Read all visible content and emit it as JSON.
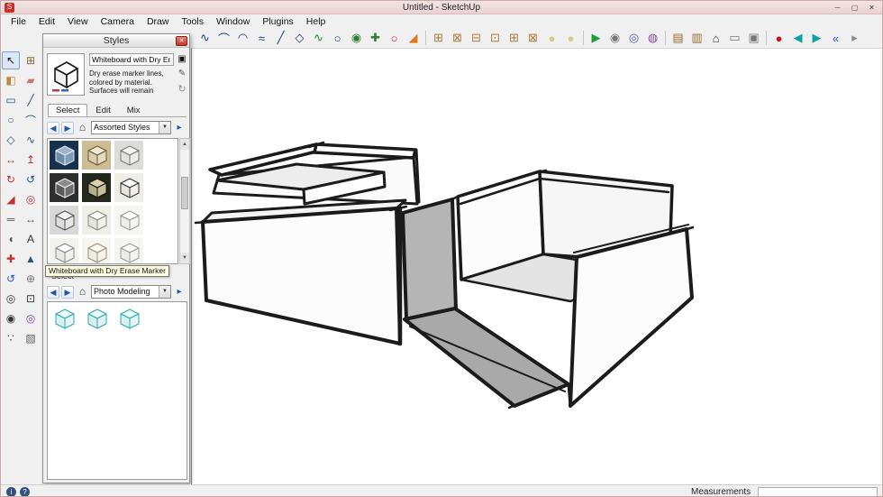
{
  "window": {
    "title": "Untitled - SketchUp",
    "logo_glyph": "S",
    "controls": {
      "minimize": "─",
      "maximize": "▢",
      "close": "✕"
    }
  },
  "menu": {
    "items": [
      {
        "name": "menu-file",
        "label": "File"
      },
      {
        "name": "menu-edit",
        "label": "Edit"
      },
      {
        "name": "menu-view",
        "label": "View"
      },
      {
        "name": "menu-camera",
        "label": "Camera"
      },
      {
        "name": "menu-draw",
        "label": "Draw"
      },
      {
        "name": "menu-tools",
        "label": "Tools"
      },
      {
        "name": "menu-window",
        "label": "Window"
      },
      {
        "name": "menu-plugins",
        "label": "Plugins"
      },
      {
        "name": "menu-help",
        "label": "Help"
      }
    ]
  },
  "toolbar": {
    "group_draw": [
      {
        "name": "freehand-icon",
        "glyph": "∿",
        "color": "#1f3f77"
      },
      {
        "name": "arc-icon",
        "glyph": "⌒",
        "color": "#1f3f77"
      },
      {
        "name": "arc-segment-icon",
        "glyph": "◠",
        "color": "#1f3f77"
      },
      {
        "name": "bezier-icon",
        "glyph": "≈",
        "color": "#1f3f77"
      },
      {
        "name": "line-icon",
        "glyph": "╱",
        "color": "#1f3f77"
      },
      {
        "name": "polygon-icon",
        "glyph": "◇",
        "color": "#1f3f77"
      },
      {
        "name": "sine-curve-icon",
        "glyph": "∿",
        "color": "#2e7d32"
      },
      {
        "name": "circle-icon",
        "glyph": "○",
        "color": "#1f3f77"
      },
      {
        "name": "spiral-icon",
        "glyph": "◉",
        "color": "#2e7d32"
      },
      {
        "name": "wrench-icon",
        "glyph": "✚",
        "color": "#2e7d32"
      },
      {
        "name": "ellipse-icon",
        "glyph": "○",
        "color": "#cc2222"
      },
      {
        "name": "wedge-icon",
        "glyph": "◢",
        "color": "#e07820"
      }
    ],
    "group_solid": [
      {
        "name": "outer-shell-icon",
        "glyph": "⊞",
        "color": "#a97c3c"
      },
      {
        "name": "intersect-icon",
        "glyph": "⊠",
        "color": "#a97c3c"
      },
      {
        "name": "union-icon",
        "glyph": "⊟",
        "color": "#a97c3c"
      },
      {
        "name": "subtract-icon",
        "glyph": "⊡",
        "color": "#a97c3c"
      },
      {
        "name": "trim-icon",
        "glyph": "⊞",
        "color": "#a97c3c"
      },
      {
        "name": "split-icon",
        "glyph": "⊠",
        "color": "#a97c3c"
      },
      {
        "name": "soften-edges-icon",
        "glyph": "●",
        "color": "#dcc692"
      },
      {
        "name": "smooth-icon",
        "glyph": "●",
        "color": "#dcc692"
      }
    ],
    "group_camera": [
      {
        "name": "play-tour-icon",
        "glyph": "▶",
        "color": "#1f9d3a"
      },
      {
        "name": "orbit-icon",
        "glyph": "◉",
        "color": "#777777"
      },
      {
        "name": "look-around-icon",
        "glyph": "◎",
        "color": "#4a5fae"
      },
      {
        "name": "walkthrough-icon",
        "glyph": "◍",
        "color": "#8a4a9a"
      }
    ],
    "group_file": [
      {
        "name": "component-library-icon",
        "glyph": "▤",
        "color": "#9a6a30"
      },
      {
        "name": "materials-book-icon",
        "glyph": "▥",
        "color": "#9a6a30"
      },
      {
        "name": "home-icon",
        "glyph": "⌂",
        "color": "#333333"
      },
      {
        "name": "save-page-icon",
        "glyph": "▭",
        "color": "#777777"
      },
      {
        "name": "layout-page-icon",
        "glyph": "▣",
        "color": "#777777"
      }
    ],
    "group_media": [
      {
        "name": "record-icon",
        "glyph": "●",
        "color": "#cc1111"
      },
      {
        "name": "previous-scene-icon",
        "glyph": "◀",
        "color": "#12a0a0"
      },
      {
        "name": "next-scene-icon",
        "glyph": "▶",
        "color": "#12a0a0"
      },
      {
        "name": "rewind-icon",
        "glyph": "«",
        "color": "#2b5fd9"
      },
      {
        "name": "advance-icon",
        "glyph": "▸",
        "color": "#8a8a8a"
      }
    ]
  },
  "left_toolbar": {
    "tools": [
      {
        "name": "select-tool",
        "glyph": "↖",
        "color": "#111111",
        "cls": "active"
      },
      {
        "name": "make-component-tool",
        "glyph": "⊞",
        "color": "#8a6d3b"
      },
      {
        "name": "paint-bucket-tool",
        "glyph": "◧",
        "color": "#b8893a"
      },
      {
        "name": "eraser-tool",
        "glyph": "▰",
        "color": "#c57777"
      },
      {
        "name": "rectangle-tool",
        "glyph": "▭",
        "color": "#28557e"
      },
      {
        "name": "line-tool",
        "glyph": "╱",
        "color": "#28557e"
      },
      {
        "name": "circle-tool",
        "glyph": "○",
        "color": "#28557e"
      },
      {
        "name": "arc-tool",
        "glyph": "⌒",
        "color": "#28557e"
      },
      {
        "name": "polygon-tool",
        "glyph": "◇",
        "color": "#28557e"
      },
      {
        "name": "freehand-tool",
        "glyph": "∿",
        "color": "#28557e"
      },
      {
        "name": "move-tool",
        "glyph": "↔",
        "color": "#c03030"
      },
      {
        "name": "pushpull-tool",
        "glyph": "↥",
        "color": "#c03030"
      },
      {
        "name": "rotate-tool",
        "glyph": "↻",
        "color": "#c03030"
      },
      {
        "name": "followme-tool",
        "glyph": "↺",
        "color": "#28557e"
      },
      {
        "name": "scale-tool",
        "glyph": "◢",
        "color": "#c03030"
      },
      {
        "name": "offset-tool",
        "glyph": "◎",
        "color": "#c03030"
      },
      {
        "name": "tape-measure-tool",
        "glyph": "═",
        "color": "#555555"
      },
      {
        "name": "dimension-tool",
        "glyph": "↔",
        "color": "#555555"
      },
      {
        "name": "protractor-tool",
        "glyph": "◖",
        "color": "#555555"
      },
      {
        "name": "text-tool",
        "glyph": "A",
        "color": "#333333"
      },
      {
        "name": "axes-tool",
        "glyph": "✚",
        "color": "#c03030"
      },
      {
        "name": "3d-text-tool",
        "glyph": "▲",
        "color": "#28557e"
      },
      {
        "name": "orbit-tool",
        "glyph": "↺",
        "color": "#2255cc"
      },
      {
        "name": "pan-tool",
        "glyph": "⊕",
        "color": "#777777"
      },
      {
        "name": "zoom-tool",
        "glyph": "◎",
        "color": "#333333"
      },
      {
        "name": "zoom-extents-tool",
        "glyph": "⊡",
        "color": "#333333"
      },
      {
        "name": "position-camera-tool",
        "glyph": "◉",
        "color": "#333333"
      },
      {
        "name": "look-around-tool",
        "glyph": "◎",
        "color": "#8a4a9a"
      },
      {
        "name": "walk-tool",
        "glyph": "∵",
        "color": "#333333"
      },
      {
        "name": "section-plane-tool",
        "glyph": "▧",
        "color": "#666666"
      }
    ]
  },
  "styles_panel": {
    "title": "Styles",
    "close_glyph": "✕",
    "style_name": "Whiteboard with Dry Era",
    "description": "Dry erase marker lines, colored by material. Surfaces will remain",
    "tabs": [
      {
        "name": "tab-select",
        "label": "Select",
        "cls": "active"
      },
      {
        "name": "tab-edit",
        "label": "Edit"
      },
      {
        "name": "tab-mix",
        "label": "Mix"
      }
    ],
    "nav": {
      "back_glyph": "◀",
      "forward_glyph": "▶",
      "home_glyph": "⌂",
      "detail_glyph": "▸",
      "dropdown_arrow": "▼",
      "primary_collection": "Assorted Styles",
      "secondary_collection": "Photo Modeling",
      "secondary_pane_label": "Select"
    },
    "tooltip": "Whiteboard with Dry Erase Marker",
    "scrollbar": {
      "up_glyph": "▲",
      "down_glyph": "▼"
    },
    "style_thumbs": [
      {
        "name": "style-thumb-blueprint",
        "bg": "#17304e",
        "top": "#9db6cc",
        "left": "#6d8aa6",
        "right": "#7e9cba",
        "line": "#dfe8f2"
      },
      {
        "name": "style-thumb-sepia",
        "bg": "#cdbd97",
        "top": "#efe8d2",
        "left": "#d9cfae",
        "right": "#e4dcc0",
        "line": "#6b5633"
      },
      {
        "name": "style-thumb-gray-sketch",
        "bg": "#dcdcda",
        "top": "#f4f4f2",
        "left": "#e2e2e0",
        "right": "#ececea",
        "line": "#777777"
      },
      {
        "name": "style-thumb-dark",
        "bg": "#2e2e2e",
        "top": "#8a8a8a",
        "left": "#5a5a5a",
        "right": "#6e6e6e",
        "line": "#eeeeee"
      },
      {
        "name": "style-thumb-night",
        "bg": "#23281c",
        "top": "#d8d2ac",
        "left": "#b4ae8a",
        "right": "#c6c09a",
        "line": "#111111"
      },
      {
        "name": "style-thumb-plain",
        "bg": "#efeee6",
        "top": "#ffffff",
        "left": "#e8e6da",
        "right": "#f2f0e6",
        "line": "#333333"
      },
      {
        "name": "style-thumb-pencil",
        "bg": "#d8d8d8",
        "top": "#f2f2f2",
        "left": "#dddddd",
        "right": "#e8e8e8",
        "line": "#555555"
      },
      {
        "name": "style-thumb-pale",
        "bg": "#eef0e8",
        "top": "#fdfdf8",
        "left": "#e4e6dc",
        "right": "#f0f2ea",
        "line": "#888888"
      },
      {
        "name": "style-thumb-white-1",
        "bg": "#f6f6f3",
        "top": "#ffffff",
        "left": "#ededea",
        "right": "#f4f4f1",
        "line": "#999999"
      },
      {
        "name": "style-thumb-white-2",
        "bg": "#f2f2ef",
        "top": "#ffffff",
        "left": "#e9e9e6",
        "right": "#f1f1ee",
        "line": "#8a8a8a"
      },
      {
        "name": "style-thumb-white-3",
        "bg": "#f7f5ef",
        "top": "#fffdf7",
        "left": "#eeece4",
        "right": "#f5f3eb",
        "line": "#9a8f77"
      },
      {
        "name": "style-thumb-white-4",
        "bg": "#f4f6f4",
        "top": "#ffffff",
        "left": "#eaeeea",
        "right": "#f2f5f2",
        "line": "#9a9a9a"
      },
      {
        "name": "style-thumb-whiteboard",
        "bg": "#ffffff",
        "top": "#ffffff",
        "left": "#f3f3f3",
        "right": "#fafafa",
        "line": "#222222",
        "cls": "selected"
      }
    ],
    "secondary_thumbs": [
      {
        "name": "photo-modeling-thumb-1",
        "bg": "#ffffff",
        "top": "#eafafa",
        "left": "#d8f0f0",
        "right": "#e4f4f4",
        "line": "#2fa8a8"
      },
      {
        "name": "photo-modeling-thumb-2",
        "bg": "#ffffff",
        "top": "#eafafa",
        "left": "#d8f0f0",
        "right": "#e4f4f4",
        "line": "#2fa8a8"
      },
      {
        "name": "photo-modeling-thumb-3",
        "bg": "#ffffff",
        "top": "#eafafa",
        "left": "#d8f0f0",
        "right": "#e4f4f4",
        "line": "#2fa8a8"
      }
    ]
  },
  "statusbar": {
    "info_glyph": "i",
    "help_glyph": "?",
    "measurements_label": "Measurements",
    "measurements_value": ""
  }
}
